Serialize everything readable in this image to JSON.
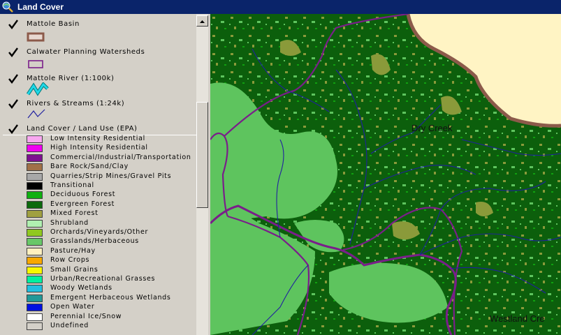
{
  "window": {
    "title": "Land Cover"
  },
  "layers": [
    {
      "name": "Mattole Basin",
      "checked": true,
      "symbol": "basin-outline-icon"
    },
    {
      "name": "Calwater Planning Watersheds",
      "checked": true,
      "symbol": "watershed-outline-icon"
    },
    {
      "name": "Mattole River (1:100k)",
      "checked": true,
      "symbol": "river-line-icon"
    },
    {
      "name": "Rivers & Streams (1:24k)",
      "checked": true,
      "symbol": "stream-line-icon"
    },
    {
      "name": "Land Cover / Land Use (EPA)",
      "checked": true,
      "symbol": "none"
    }
  ],
  "land_cover_classes": [
    {
      "label": "Low Intensity Residential",
      "color": "#f8a8f0"
    },
    {
      "label": "High Intensity Residential",
      "color": "#f000f0"
    },
    {
      "label": "Commercial/Industrial/Transportation",
      "color": "#7e1090"
    },
    {
      "label": "Bare Rock/Sand/Clay",
      "color": "#a07048"
    },
    {
      "label": "Quarries/Strip Mines/Gravel Pits",
      "color": "#a8a8a8"
    },
    {
      "label": "Transitional",
      "color": "#000000"
    },
    {
      "label": "Deciduous Forest",
      "color": "#10b010"
    },
    {
      "label": "Evergreen Forest",
      "color": "#0c6a0c"
    },
    {
      "label": "Mixed Forest",
      "color": "#a0a040"
    },
    {
      "label": "Shrubland",
      "color": "#b0f0b0"
    },
    {
      "label": "Orchards/Vineyards/Other",
      "color": "#90c820"
    },
    {
      "label": "Grasslands/Herbaceous",
      "color": "#68c868"
    },
    {
      "label": "Pasture/Hay",
      "color": "#fff0c0"
    },
    {
      "label": "Row Crops",
      "color": "#f8a800"
    },
    {
      "label": "Small Grains",
      "color": "#f8f800"
    },
    {
      "label": "Urban/Recreational Grasses",
      "color": "#00f0a0"
    },
    {
      "label": "Woody Wetlands",
      "color": "#20c0e0"
    },
    {
      "label": "Emergent Herbaceous Wetlands",
      "color": "#209898"
    },
    {
      "label": "Open Water",
      "color": "#0010e0"
    },
    {
      "label": "Perennial Ice/Snow",
      "color": "#ffffff"
    },
    {
      "label": "Undefined",
      "color": "#d4d0c8"
    }
  ],
  "map": {
    "labels": [
      {
        "text": "Dry Creek"
      },
      {
        "text": "Westland Cre"
      }
    ],
    "colors": {
      "evergreen": "#0c5f0c",
      "grassland": "#5ec45e",
      "mixed": "#8a9a3a",
      "outside_basin": "#fff4c4",
      "basin_outline": "#8c5a4a",
      "watershed_outline": "#7a1e8a",
      "stream": "#2020a0"
    }
  }
}
